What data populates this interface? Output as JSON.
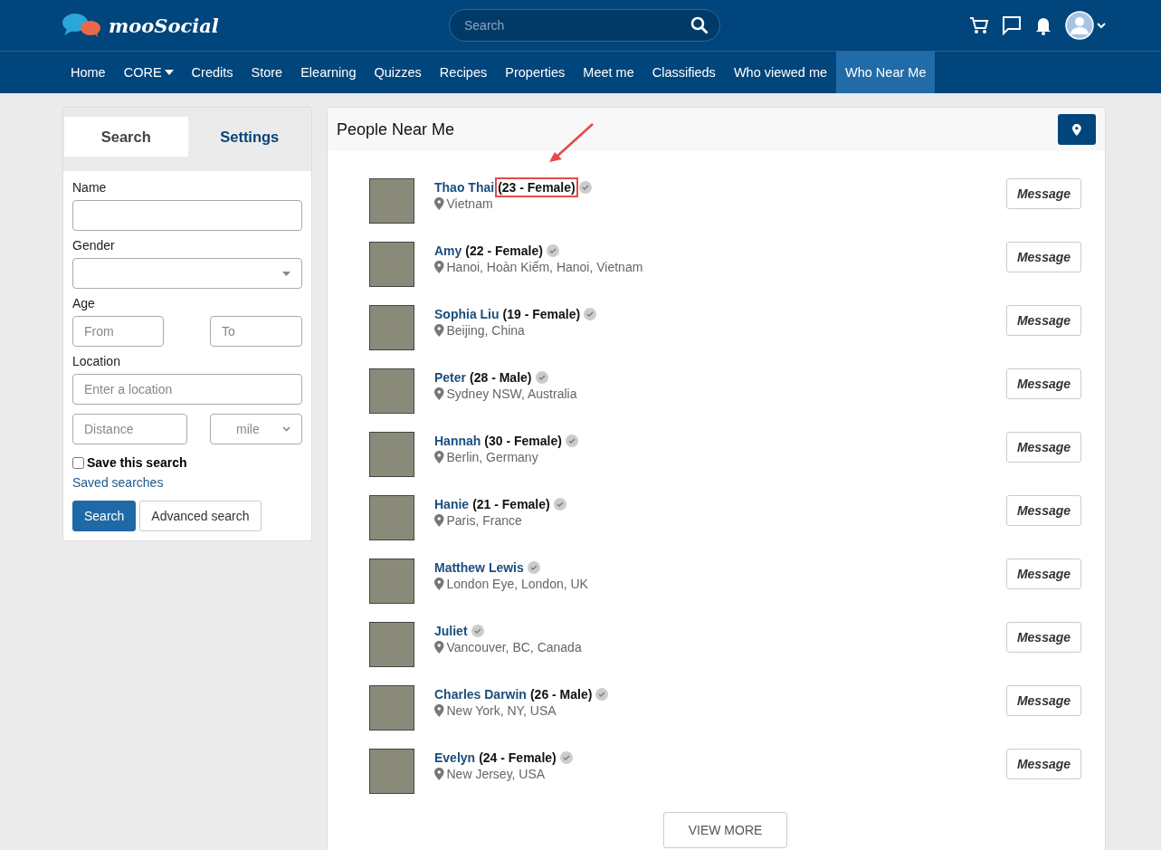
{
  "header": {
    "logo": "mooSocial",
    "search": {
      "placeholder": "Search"
    }
  },
  "nav": [
    {
      "label": "Home",
      "selected": false,
      "dropdown": false
    },
    {
      "label": "CORE",
      "selected": false,
      "dropdown": true
    },
    {
      "label": "Credits",
      "selected": false,
      "dropdown": false
    },
    {
      "label": "Store",
      "selected": false,
      "dropdown": false
    },
    {
      "label": "Elearning",
      "selected": false,
      "dropdown": false
    },
    {
      "label": "Quizzes",
      "selected": false,
      "dropdown": false
    },
    {
      "label": "Recipes",
      "selected": false,
      "dropdown": false
    },
    {
      "label": "Properties",
      "selected": false,
      "dropdown": false
    },
    {
      "label": "Meet me",
      "selected": false,
      "dropdown": false
    },
    {
      "label": "Classifieds",
      "selected": false,
      "dropdown": false
    },
    {
      "label": "Who viewed me",
      "selected": false,
      "dropdown": false
    },
    {
      "label": "Who Near Me",
      "selected": true,
      "dropdown": false
    }
  ],
  "sidebar": {
    "tabs": [
      {
        "label": "Search",
        "selected": true
      },
      {
        "label": "Settings",
        "selected": false
      }
    ],
    "name_label": "Name",
    "gender_label": "Gender",
    "age_label": "Age",
    "age_from": {
      "placeholder": "From"
    },
    "age_to": {
      "placeholder": "To"
    },
    "location_label": "Location",
    "location": {
      "placeholder": "Enter a location"
    },
    "distance": {
      "placeholder": "Distance"
    },
    "unit": "mile",
    "save_search": {
      "label": "Save this search",
      "checked": false
    },
    "saved_searches": "Saved searches",
    "buttons": [
      {
        "label": "Search",
        "kind": "primary"
      },
      {
        "label": "Advanced search",
        "kind": "default"
      }
    ]
  },
  "main": {
    "title": "People Near Me",
    "people": [
      {
        "name": "Thao Thai",
        "detail": "(23 - Female)",
        "location": "Vietnam",
        "highlighted": true,
        "action": "Message"
      },
      {
        "name": "Amy",
        "detail": "(22 - Female)",
        "location": "Hanoi, Hoàn Kiếm, Hanoi, Vietnam",
        "action": "Message"
      },
      {
        "name": "Sophia Liu",
        "detail": "(19 - Female)",
        "location": "Beijing, China",
        "action": "Message"
      },
      {
        "name": "Peter",
        "detail": "(28 - Male)",
        "location": "Sydney NSW, Australia",
        "action": "Message"
      },
      {
        "name": "Hannah",
        "detail": "(30 - Female)",
        "location": "Berlin, Germany",
        "action": "Message"
      },
      {
        "name": "Hanie",
        "detail": "(21 - Female)",
        "location": "Paris, France",
        "action": "Message"
      },
      {
        "name": "Matthew Lewis",
        "location": "London Eye, London, UK",
        "action": "Message"
      },
      {
        "name": "Juliet",
        "location": "Vancouver, BC, Canada",
        "action": "Message"
      },
      {
        "name": "Charles Darwin",
        "detail": "(26 - Male)",
        "location": "New York, NY, USA",
        "action": "Message"
      },
      {
        "name": "Evelyn",
        "detail": "(24 - Female)",
        "location": "New Jersey, USA",
        "action": "Message"
      }
    ],
    "view_more": "VIEW MORE"
  }
}
